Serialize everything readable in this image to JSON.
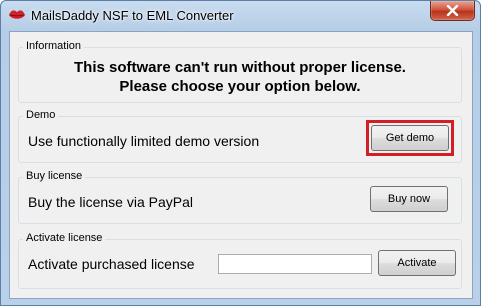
{
  "window": {
    "title": "MailsDaddy NSF to EML Converter"
  },
  "information": {
    "legend": "Information",
    "line1": "This software can't run without proper license.",
    "line2": "Please choose your option below."
  },
  "demo": {
    "legend": "Demo",
    "description": "Use functionally limited demo version",
    "button": "Get demo"
  },
  "buy": {
    "legend": "Buy license",
    "description": "Buy the license via PayPal",
    "button": "Buy now"
  },
  "activate": {
    "legend": "Activate license",
    "description": "Activate purchased license",
    "input_value": "",
    "button": "Activate"
  },
  "icons": {
    "app": "lips-logo-icon",
    "close": "close-icon"
  },
  "colors": {
    "highlight": "#d21f26",
    "close_button": "#c8442e"
  }
}
